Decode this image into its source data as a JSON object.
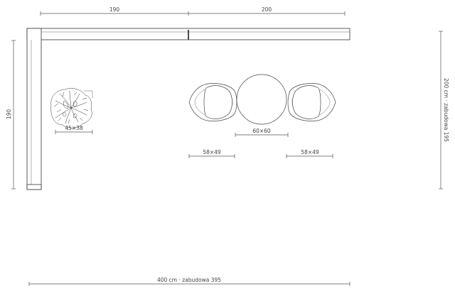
{
  "dimensions": {
    "top_left": "190",
    "top_right": "200",
    "left_side": "190",
    "right_side": "200 cm · zabudowa 195",
    "bottom": "400 cm · zabudowa 395"
  },
  "furniture": {
    "plant_label": "45×38",
    "table_label": "60×60",
    "chair_left_label": "58×49",
    "chair_right_label": "58×49"
  },
  "icons": [
    "plant-icon",
    "chair-icon",
    "round-table-icon"
  ]
}
